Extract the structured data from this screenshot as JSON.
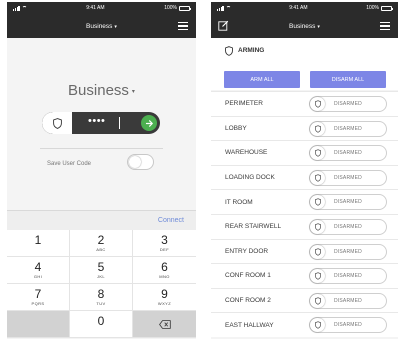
{
  "colors": {
    "header": "#2b2b2b",
    "accent": "#7d86e6",
    "go_button": "#4caf50",
    "link": "#6f8bd8"
  },
  "left": {
    "status": {
      "time": "9:41 AM",
      "battery": "100%"
    },
    "nav": {
      "title": "Business",
      "caret": "▾",
      "menu_icon": "hamburger-icon"
    },
    "business_title": "Business",
    "business_caret": "▾",
    "code_field": {
      "masked_value": "••••",
      "shield_icon": "shield-icon",
      "submit_icon": "arrow-right-icon"
    },
    "save_user_code": {
      "label": "Save User Code",
      "enabled": false
    },
    "connect_label": "Connect",
    "keypad": [
      {
        "num": "1",
        "letters": ""
      },
      {
        "num": "2",
        "letters": "ABC"
      },
      {
        "num": "3",
        "letters": "DEF"
      },
      {
        "num": "4",
        "letters": "GHI"
      },
      {
        "num": "5",
        "letters": "JKL"
      },
      {
        "num": "6",
        "letters": "MNO"
      },
      {
        "num": "7",
        "letters": "PQRS"
      },
      {
        "num": "8",
        "letters": "TUV"
      },
      {
        "num": "9",
        "letters": "WXYZ"
      },
      {
        "num": "",
        "letters": ""
      },
      {
        "num": "0",
        "letters": ""
      },
      {
        "num": "",
        "letters": ""
      }
    ],
    "backspace_icon": "backspace-icon"
  },
  "right": {
    "status": {
      "time": "9:41 AM",
      "battery": "100%"
    },
    "nav": {
      "title": "Business",
      "caret": "▾",
      "edit_icon": "edit-icon",
      "menu_icon": "hamburger-icon"
    },
    "arming": {
      "title": "ARMING",
      "arm_all": "ARM ALL",
      "disarm_all": "DISARM ALL"
    },
    "zones": [
      {
        "name": "PERIMETER",
        "state": "DISARMED"
      },
      {
        "name": "LOBBY",
        "state": "DISARMED"
      },
      {
        "name": "WAREHOUSE",
        "state": "DISARMED"
      },
      {
        "name": "LOADING DOCK",
        "state": "DISARMED"
      },
      {
        "name": "IT ROOM",
        "state": "DISARMED"
      },
      {
        "name": "REAR STAIRWELL",
        "state": "DISARMED"
      },
      {
        "name": "ENTRY DOOR",
        "state": "DISARMED"
      },
      {
        "name": "CONF ROOM 1",
        "state": "DISARMED"
      },
      {
        "name": "CONF ROOM 2",
        "state": "DISARMED"
      },
      {
        "name": "EAST HALLWAY",
        "state": "DISARMED"
      }
    ]
  }
}
